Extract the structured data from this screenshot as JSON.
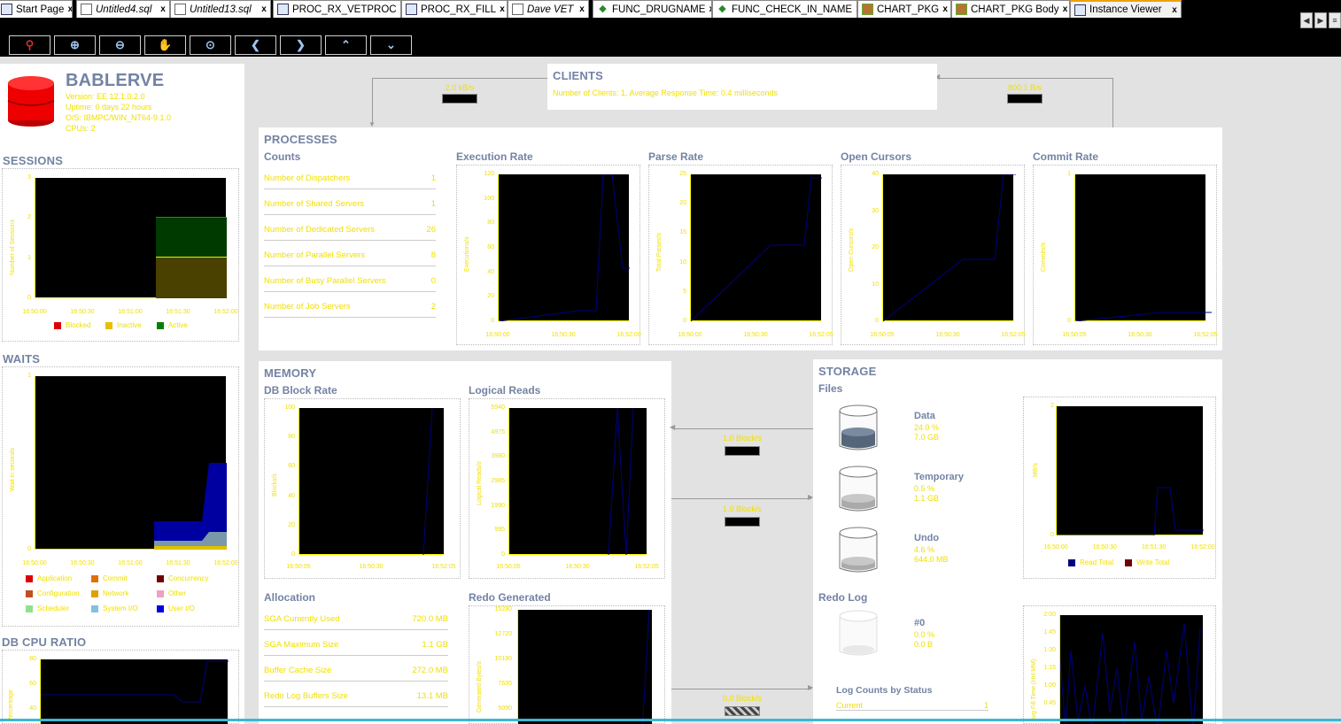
{
  "tabs": [
    {
      "label": "Start Page",
      "italic": false,
      "icon": "globe-icon"
    },
    {
      "label": "Untitled4.sql",
      "italic": true,
      "icon": "sql-file-icon"
    },
    {
      "label": "Untitled13.sql",
      "italic": true,
      "icon": "sql-file-icon"
    },
    {
      "label": "PROC_RX_VETPROC",
      "italic": false,
      "icon": "procedure-icon"
    },
    {
      "label": "PROC_RX_FILL",
      "italic": false,
      "icon": "procedure-icon"
    },
    {
      "label": "Dave VET",
      "italic": true,
      "icon": "sql-worksheet-icon"
    },
    {
      "label": "FUNC_DRUGNAME",
      "italic": false,
      "icon": "function-icon"
    },
    {
      "label": "FUNC_CHECK_IN_NAME",
      "italic": false,
      "icon": "function-icon"
    },
    {
      "label": "CHART_PKG",
      "italic": false,
      "icon": "package-icon"
    },
    {
      "label": "CHART_PKG Body",
      "italic": false,
      "icon": "package-icon"
    },
    {
      "label": "Instance Viewer",
      "italic": false,
      "icon": "instance-viewer-icon",
      "active": true
    }
  ],
  "toolbar": [
    "pin-icon",
    "zoom-in-icon",
    "zoom-out-icon",
    "pan-icon",
    "zoom-fit-icon",
    "arrow-left-icon",
    "arrow-right-icon",
    "arrow-up-icon",
    "arrow-down-icon"
  ],
  "instance": {
    "name": "BABLERVE",
    "version": "Version: EE 12.1.0.2.0",
    "uptime": "Uptime: 0 days 22 hours",
    "os": "O/S: IBMPC/WIN_NT64-9.1.0",
    "cpus": "CPUs: 2"
  },
  "clients": {
    "title": "CLIENTS",
    "summary": "Number of Clients: 1,   Average Response Time: 0.4 milliseconds",
    "left_rate": "2.0 kB/s",
    "right_rate": "800.1 B/s"
  },
  "sessions": {
    "title": "SESSIONS",
    "ylabel": "Number of Sessions",
    "yticks": [
      "3",
      "2",
      "1",
      "0"
    ],
    "xticks": [
      "16:50:00",
      "16:50:30",
      "16:51:00",
      "16:51:30",
      "16:52:00"
    ],
    "legend": [
      {
        "label": "Blocked",
        "color": "#e00000"
      },
      {
        "label": "Inactive",
        "color": "#e8c000"
      },
      {
        "label": "Active",
        "color": "#008000"
      }
    ]
  },
  "waits": {
    "title": "WAITS",
    "ylabel": "Wait in seconds",
    "yticks": [
      "1",
      "0"
    ],
    "xticks": [
      "16:50:00",
      "16:50:30",
      "16:51:00",
      "16:51:30",
      "16:52:00"
    ],
    "legend": [
      {
        "label": "Application",
        "color": "#e00000"
      },
      {
        "label": "Commit",
        "color": "#e07000"
      },
      {
        "label": "Concurrency",
        "color": "#700000"
      },
      {
        "label": "Configuration",
        "color": "#c05020"
      },
      {
        "label": "Network",
        "color": "#e0a000"
      },
      {
        "label": "Other",
        "color": "#f0a0c0"
      },
      {
        "label": "Scheduler",
        "color": "#90e090"
      },
      {
        "label": "System I/O",
        "color": "#80c0e0"
      },
      {
        "label": "User I/O",
        "color": "#0000e0"
      }
    ]
  },
  "cpu": {
    "title": "DB CPU RATIO",
    "ylabel": "Percentage",
    "yticks": [
      "80",
      "60",
      "40"
    ]
  },
  "processes": {
    "title": "PROCESSES",
    "counts_title": "Counts",
    "counts": [
      {
        "label": "Number of Dispatchers",
        "value": "1"
      },
      {
        "label": "Number of Shared Servers",
        "value": "1"
      },
      {
        "label": "Number of Dedicated Servers",
        "value": "26"
      },
      {
        "label": "Number of Parallel Servers",
        "value": "8"
      },
      {
        "label": "Number of Busy Parallel Servers",
        "value": "0"
      },
      {
        "label": "Number of Job Servers",
        "value": "2"
      }
    ]
  },
  "proc_charts": [
    {
      "title": "Execution Rate",
      "ylabel": "Executions/s",
      "yticks": [
        "120",
        "100",
        "80",
        "60",
        "40",
        "20",
        "0"
      ],
      "xticks": [
        "16:50:00",
        "16:50:30",
        "16:52:00"
      ]
    },
    {
      "title": "Parse Rate",
      "ylabel": "Total Parses/s",
      "yticks": [
        "25",
        "20",
        "15",
        "10",
        "5",
        "0"
      ],
      "xticks": [
        "16:50:00",
        "16:50:30",
        "16:52:05"
      ]
    },
    {
      "title": "Open Cursors",
      "ylabel": "Open Cursors/s",
      "yticks": [
        "40",
        "30",
        "20",
        "10",
        "0"
      ],
      "xticks": [
        "16:50:05",
        "16:50:30",
        "16:52:05"
      ]
    },
    {
      "title": "Commit Rate",
      "ylabel": "Commits/s",
      "yticks": [
        "1",
        "0"
      ],
      "xticks": [
        "16:50:05",
        "16:50:30",
        "16:52:05"
      ]
    }
  ],
  "memory": {
    "title": "MEMORY",
    "block_rate": {
      "title": "DB Block Rate",
      "ylabel": "Blocks/s",
      "yticks": [
        "100",
        "80",
        "60",
        "40",
        "20",
        "0"
      ],
      "xticks": [
        "16:50:05",
        "16:50:30",
        "16:52:05"
      ]
    },
    "logical_reads": {
      "title": "Logical Reads",
      "ylabel": "Logical Reads/s",
      "yticks": [
        "5940",
        "4975",
        "3980",
        "2985",
        "1990",
        "995",
        "0"
      ],
      "xticks": [
        "16:50:05",
        "16:50:30",
        "16:52:05"
      ]
    },
    "allocation_title": "Allocation",
    "allocation": [
      {
        "label": "SGA Currently Used",
        "value": "720.0 MB"
      },
      {
        "label": "SGA Maximum Size",
        "value": "1.1 GB"
      },
      {
        "label": "Buffer Cache Size",
        "value": "272.0 MB"
      },
      {
        "label": "Redo Log Buffers Size",
        "value": "13.1 MB"
      }
    ],
    "redo": {
      "title": "Redo Generated",
      "ylabel": "Generated Bytes/s",
      "yticks": [
        "15280",
        "12720",
        "10180",
        "7635",
        "5090"
      ]
    }
  },
  "io_rates": {
    "top": "1.0 Block/s",
    "mid": "1.0 Block/s",
    "bottom": "0.0 Block/s"
  },
  "storage": {
    "title": "STORAGE",
    "files_title": "Files",
    "files": [
      {
        "label": "Data",
        "pct": "24.0 %",
        "size": "7.0 GB"
      },
      {
        "label": "Temporary",
        "pct": "0.5 %",
        "size": "1.1 GB"
      },
      {
        "label": "Undo",
        "pct": "4.6 %",
        "size": "644.0 MB"
      }
    ],
    "io_chart": {
      "ylabel": "MB/s",
      "yticks": [
        "2",
        "0"
      ],
      "xticks": [
        "16:50:00",
        "16:50:30",
        "16:51:30",
        "16:52:00"
      ],
      "legend": [
        {
          "label": "Read Total",
          "color": "#000080"
        },
        {
          "label": "Write Total",
          "color": "#700000"
        }
      ]
    },
    "redo_log_title": "Redo Log",
    "redo_log": {
      "label": "#0",
      "pct": "0.0 %",
      "size": "0.0 B"
    },
    "log_counts_title": "Log Counts by Status",
    "log_counts": [
      {
        "label": "Current",
        "value": "1"
      }
    ],
    "fill_chart": {
      "ylabel": "Avg Fill Time (HH:MM)",
      "yticks": [
        "2:00",
        "1:45",
        "1:30",
        "1:15",
        "1:00",
        "0:45"
      ]
    }
  }
}
